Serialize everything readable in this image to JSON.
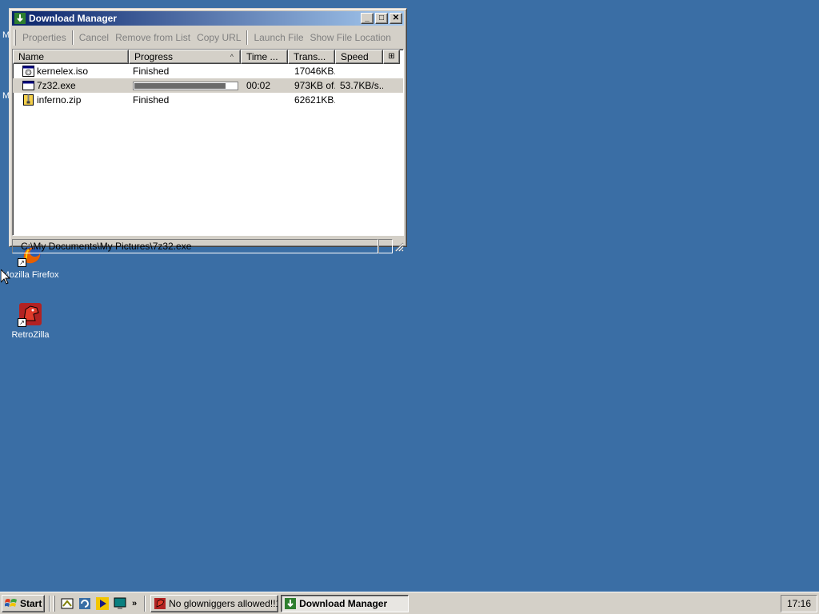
{
  "desktop": {
    "icons": [
      {
        "label": "Mozilla Firefox"
      },
      {
        "label": "RetroZilla"
      }
    ],
    "edge_glyphs": [
      "M",
      "M"
    ]
  },
  "window": {
    "title": "Download Manager",
    "controls": {
      "minimize": "_",
      "maximize": "□",
      "close": "✕"
    },
    "toolbar": {
      "properties": "Properties",
      "cancel": "Cancel",
      "remove": "Remove from List",
      "copy_url": "Copy URL",
      "launch": "Launch File",
      "show_location": "Show File Location"
    },
    "columns": {
      "name": "Name",
      "progress": "Progress",
      "time": "Time ...",
      "transferred": "Trans...",
      "speed": "Speed",
      "sort_indicator": "^"
    },
    "downloads": [
      {
        "name": "kernelex.iso",
        "progress": "Finished",
        "time": "",
        "transferred": "17046KB...",
        "speed": ""
      },
      {
        "name": "7z32.exe",
        "progress_fraction": 0.89,
        "time": "00:02",
        "transferred": "973KB of...",
        "speed": "53.7KB/s..."
      },
      {
        "name": "inferno.zip",
        "progress": "Finished",
        "time": "",
        "transferred": "62621KB...",
        "speed": ""
      }
    ],
    "status_path": "C:\\My Documents\\My Pictures\\7z32.exe"
  },
  "taskbar": {
    "start_label": "Start",
    "chevron": "»",
    "tasks": [
      {
        "label": "No glowniggers allowed!!1 ...",
        "active": false
      },
      {
        "label": "Download Manager",
        "active": true
      }
    ],
    "clock": "17:16"
  },
  "colors": {
    "desktop": "#3a6ea5",
    "title_gradient_start": "#0a246a",
    "title_gradient_end": "#a6caf0",
    "face": "#d4d0c8"
  }
}
